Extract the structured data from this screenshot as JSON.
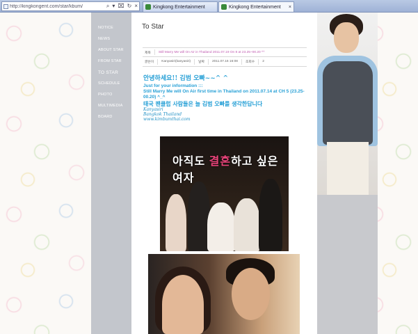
{
  "browser": {
    "url": "http://kingkongent.com/star/kbum/",
    "tabs": [
      {
        "label": "Kingkong Entertainment",
        "active": false
      },
      {
        "label": "Kingkong Entertainment",
        "active": true
      }
    ]
  },
  "nav": {
    "items": [
      "NOTICE",
      "NEWS",
      "ABOUT STAR",
      "FROM STAR",
      "TO STAR",
      "SCHEDULE",
      "PHOTO",
      "MULTIMEDIA",
      "BOARD"
    ]
  },
  "content": {
    "title": "To Star",
    "meta": {
      "subject_label": "제목",
      "subject": "Still Marry Me will On Air in Thailand 2011.07.19 On 8 at 23.25~00.20 ^^",
      "author_label": "글쓴이",
      "author": "Kanyasiri(kanyasiri)",
      "date_label": "날짜",
      "date": "2011.07.16 16:08",
      "views_label": "조회수",
      "views": "2"
    },
    "post": {
      "greeting": "안녕하세요!! 김범 오빠~~^ ^",
      "info1": "Just for your information :::",
      "info2": "Still Marry Me will On Air first time in Thailand on 2011.07.14 at CH 5 (23.25-00.20) ^_^",
      "thai_fans": "태국 팬클럽 사람들은 늘 김범 오빠를 생각한답니다",
      "sig_name": "Kanyasiri",
      "sig_city": "Bangkok Thailand",
      "sig_site": "www.kimbumthai.com"
    },
    "poster1_title_a": "아직도 ",
    "poster1_title_b": "결혼",
    "poster1_title_c": "하고 싶은 여자"
  },
  "colors": {
    "nav_bg": "#c3c6cc",
    "accent_blue": "#27a0d6",
    "subject_pink": "#c05ab0"
  }
}
